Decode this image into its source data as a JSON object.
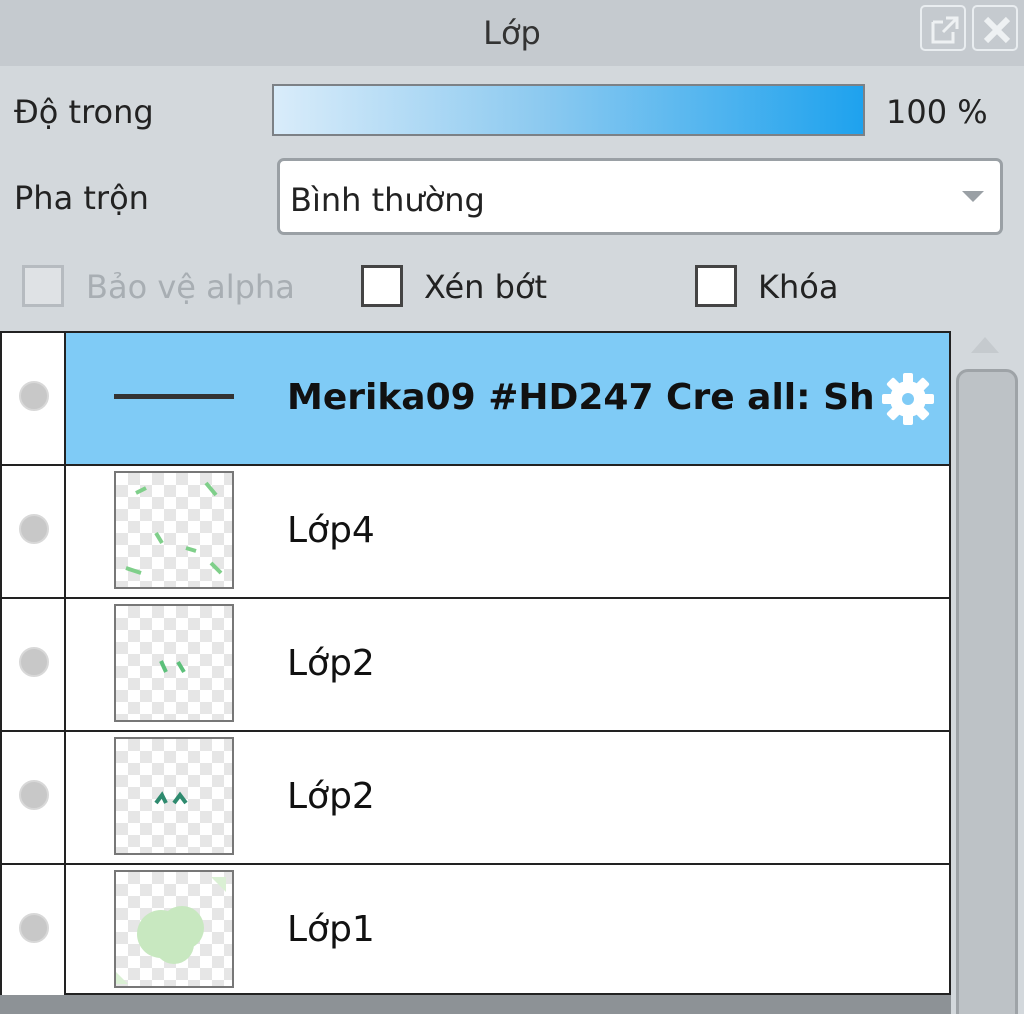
{
  "panel": {
    "title": "Lớp"
  },
  "opacity": {
    "label": "Độ trong",
    "value": "100 %",
    "level_fraction": 1.0
  },
  "blend": {
    "label": "Pha trộn",
    "value": "Bình thường"
  },
  "options": [
    {
      "label": "Bảo vệ alpha",
      "checked": false,
      "disabled": true
    },
    {
      "label": "Xén bớt",
      "checked": false,
      "disabled": false
    },
    {
      "label": "Khóa",
      "checked": false,
      "disabled": false
    }
  ],
  "layers": [
    {
      "name": "Merika09 #HD247 Cre all: Sh",
      "selected": true,
      "type": "folder"
    },
    {
      "name": "Lớp4",
      "selected": false,
      "type": "layer"
    },
    {
      "name": "Lớp2",
      "selected": false,
      "type": "layer"
    },
    {
      "name": "Lớp2",
      "selected": false,
      "type": "layer"
    },
    {
      "name": "Lớp1",
      "selected": false,
      "type": "layer"
    }
  ],
  "colors": {
    "selected_row": "#7fcbf6",
    "opacity_bar_end": "#1ea2ee"
  },
  "icons": {
    "popout": "popout-icon",
    "close": "close-icon",
    "settings": "gear-icon",
    "visibility": "visibility-dot-icon"
  }
}
